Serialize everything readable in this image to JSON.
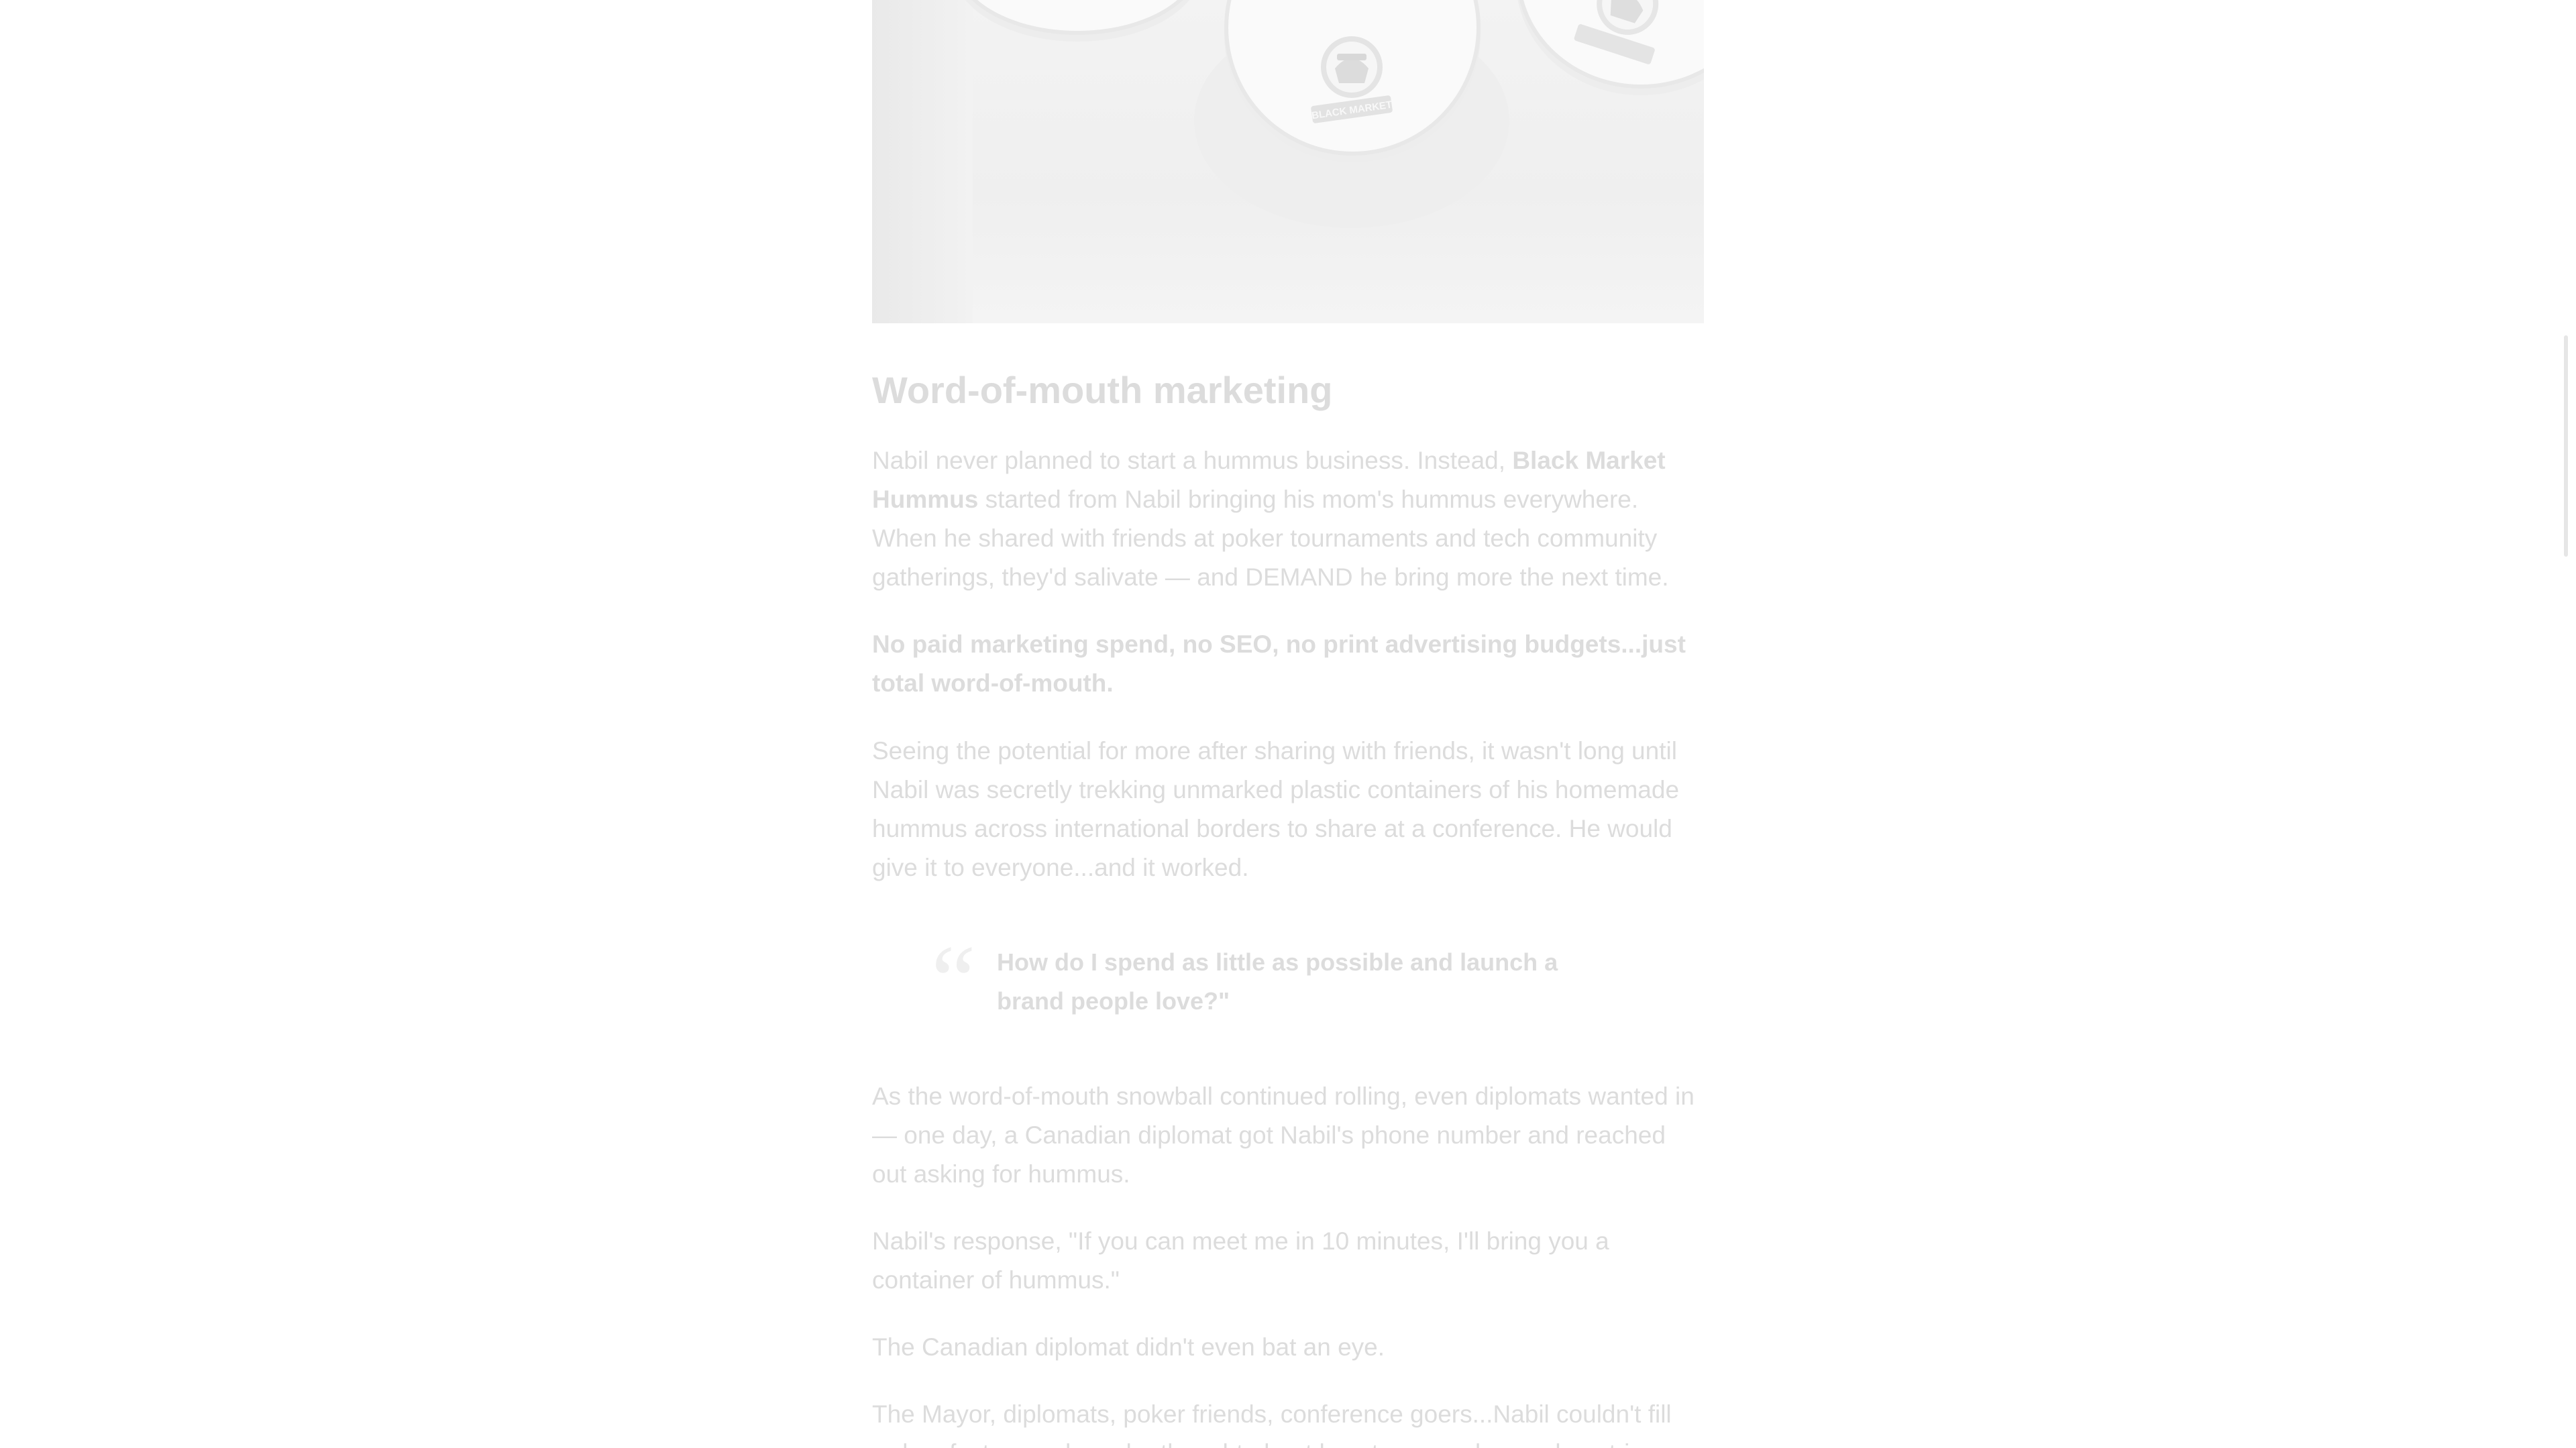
{
  "article": {
    "hero_image": {
      "alt": "Black Market hummus containers in a tray",
      "logo_text": "BLACK MARKET"
    },
    "section_title": "Word-of-mouth marketing",
    "p1": {
      "before": "Nabil never planned to start a hummus business. Instead, ",
      "brand": "Black Market Hummus",
      "after": " started from Nabil bringing his mom's hummus everywhere. When he shared with friends at poker tournaments and tech community gatherings, they'd salivate — and DEMAND he bring more the next time."
    },
    "p2": "No paid marketing spend, no SEO, no print advertising budgets...just total word-of-mouth.",
    "p3": "Seeing the potential for more after sharing with friends, it wasn't long until Nabil was secretly trekking unmarked plastic containers of his homemade hummus across international borders to share at a conference. He would give it to everyone...and it worked.",
    "quote": {
      "mark": "“",
      "text": "How do I spend as little as possible and launch a brand people love?\""
    },
    "p4": "As the word-of-mouth snowball continued rolling, even diplomats wanted in — one day, a Canadian diplomat got Nabil's phone number and reached out asking for hummus.",
    "p5": "Nabil's response, \"If you can meet me in 10 minutes, I'll bring you a container of hummus.\"",
    "p6": "The Canadian diplomat didn't even bat an eye.",
    "p7": "The Mayor, diplomats, poker friends, conference goers...Nabil couldn't fill orders fast enough, so he thought about how to expand on a shoestring"
  },
  "colors": {
    "text": "#dcdcdc",
    "background": "#ffffff",
    "quote_mark": "#efefef"
  }
}
